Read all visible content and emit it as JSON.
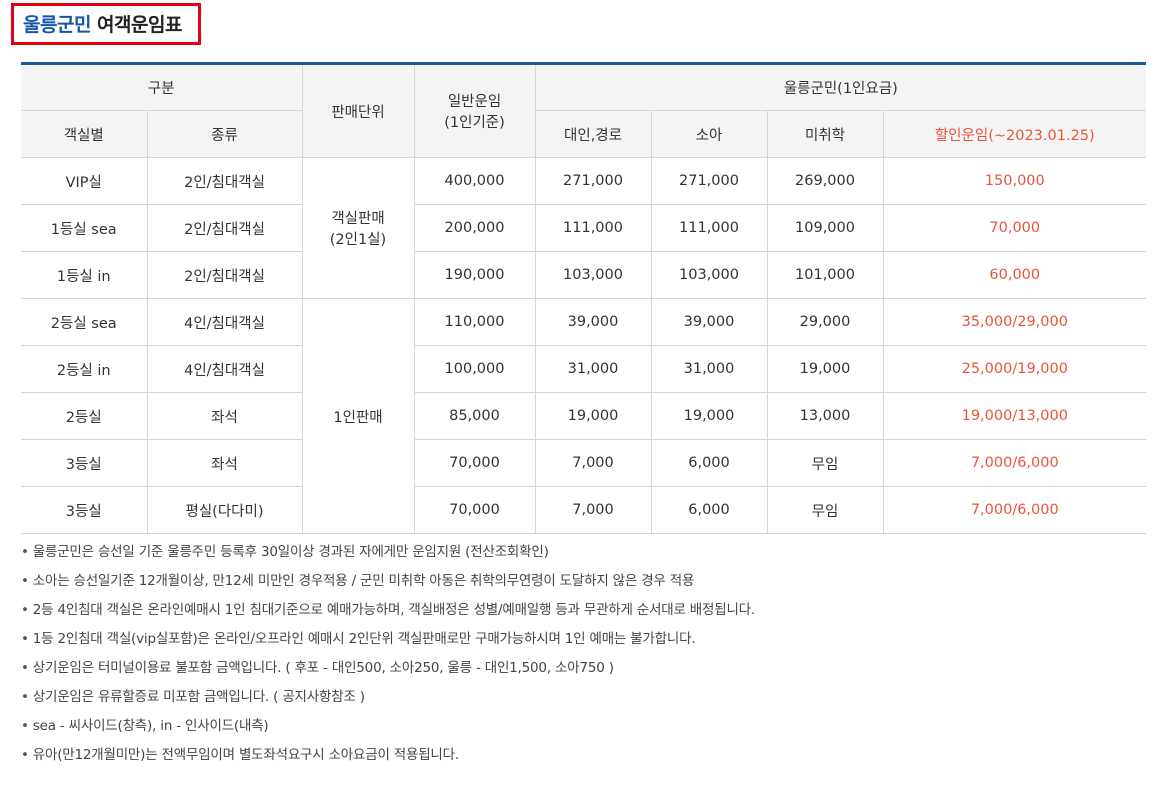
{
  "title": {
    "accent": "울릉군민",
    "rest": "여객운임표"
  },
  "headers": {
    "category": "구분",
    "sales_unit": "판매단위",
    "regular_fare_line1": "일반운임",
    "regular_fare_line2": "(1인기준)",
    "resident_group": "울릉군민(1인요금)",
    "room_type": "객실별",
    "kind": "종류",
    "adult": "대인,경로",
    "child": "소아",
    "preschool": "미취학",
    "discount": "할인운임(~2023.01.25)"
  },
  "sales_units": {
    "cabin_line1": "객실판매",
    "cabin_line2": "(2인1실)",
    "per_person": "1인판매"
  },
  "rows": [
    {
      "room": "VIP실",
      "kind": "2인/침대객실",
      "regular": "400,000",
      "adult": "271,000",
      "child": "271,000",
      "preschool": "269,000",
      "discount": "150,000"
    },
    {
      "room": "1등실 sea",
      "kind": "2인/침대객실",
      "regular": "200,000",
      "adult": "111,000",
      "child": "111,000",
      "preschool": "109,000",
      "discount": "70,000"
    },
    {
      "room": "1등실 in",
      "kind": "2인/침대객실",
      "regular": "190,000",
      "adult": "103,000",
      "child": "103,000",
      "preschool": "101,000",
      "discount": "60,000"
    },
    {
      "room": "2등실 sea",
      "kind": "4인/침대객실",
      "regular": "110,000",
      "adult": "39,000",
      "child": "39,000",
      "preschool": "29,000",
      "discount": "35,000/29,000"
    },
    {
      "room": "2등실 in",
      "kind": "4인/침대객실",
      "regular": "100,000",
      "adult": "31,000",
      "child": "31,000",
      "preschool": "19,000",
      "discount": "25,000/19,000"
    },
    {
      "room": "2등실",
      "kind": "좌석",
      "regular": "85,000",
      "adult": "19,000",
      "child": "19,000",
      "preschool": "13,000",
      "discount": "19,000/13,000"
    },
    {
      "room": "3등실",
      "kind": "좌석",
      "regular": "70,000",
      "adult": "7,000",
      "child": "6,000",
      "preschool": "무임",
      "discount": "7,000/6,000"
    },
    {
      "room": "3등실",
      "kind": "평실(다다미)",
      "regular": "70,000",
      "adult": "7,000",
      "child": "6,000",
      "preschool": "무임",
      "discount": "7,000/6,000"
    }
  ],
  "notes": [
    "울릉군민은 승선일 기준 울릉주민 등록후 30일이상 경과된 자에게만 운임지원 (전산조회확인)",
    "소아는 승선일기준 12개월이상, 만12세 미만인 경우적용 / 군민 미취학 아동은 취학의무연령이 도달하지 않은 경우 적용",
    "2등 4인침대 객실은 온라인예매시 1인 침대기준으로 예매가능하며, 객실배정은 성별/예매일행 등과 무관하게 순서대로 배정됩니다.",
    "1등 2인침대 객실(vip실포함)은 온라인/오프라인 예매시 2인단위 객실판매로만 구매가능하시며 1인 예매는 불가합니다.",
    "상기운임은 터미널이용료 불포함 금액입니다. ( 후포 - 대인500, 소아250, 울릉 - 대인1,500, 소아750 )",
    "상기운임은 유류할증료 미포함 금액입니다. ( 공지사항참조 )",
    "sea - 씨사이드(창측), in - 인사이드(내측)",
    "유아(만12개월미만)는 전액무임이며 별도좌석요구시 소아요금이 적용됩니다."
  ],
  "colors": {
    "accent": "#1656a6",
    "highlight_box": "#e50012",
    "table_top_border": "#1e56a0",
    "discount": "#e8553a"
  }
}
